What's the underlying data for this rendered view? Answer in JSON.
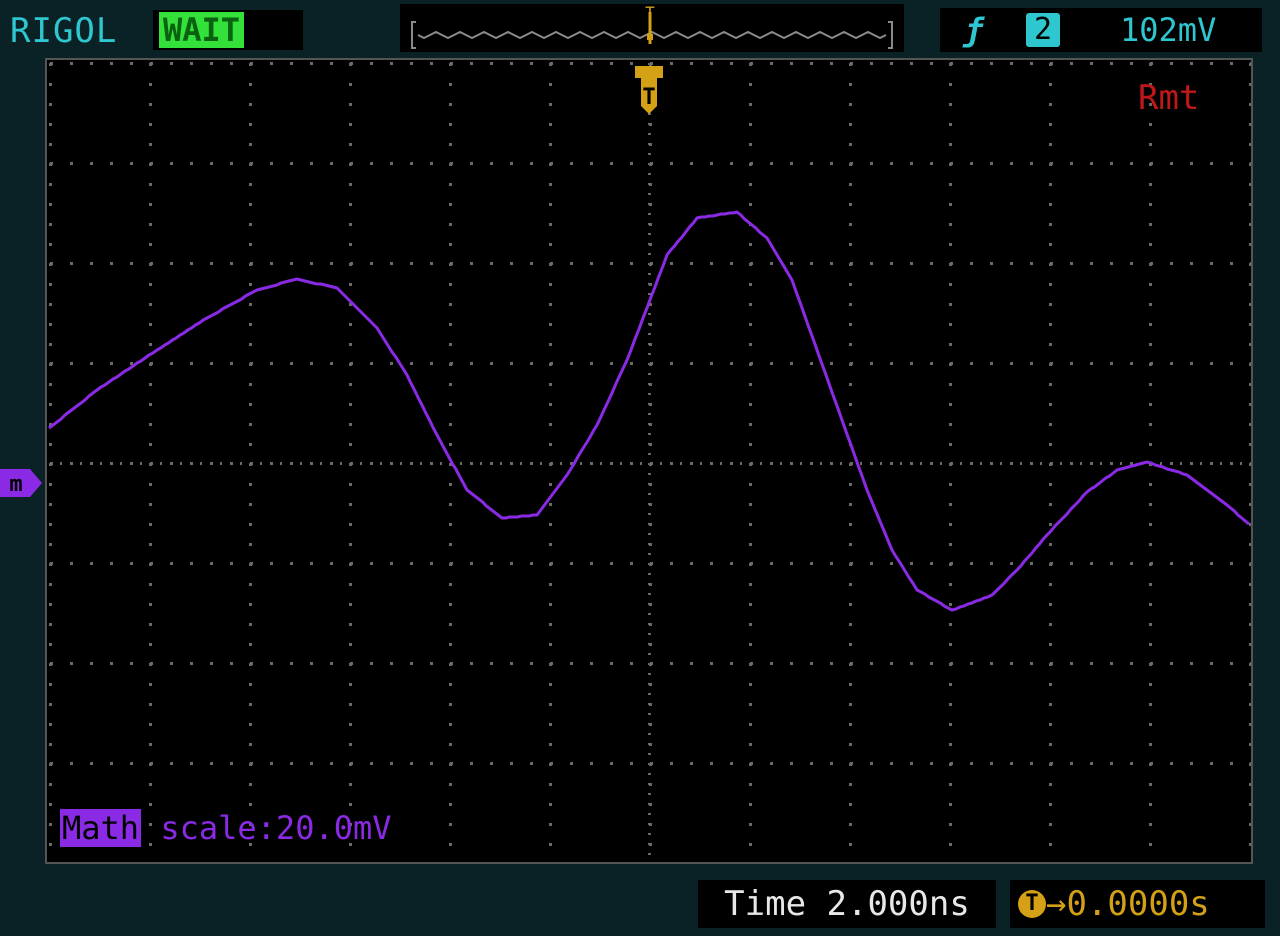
{
  "header": {
    "brand": "RIGOL",
    "run_status": "WAIT",
    "trigger_channel": "2",
    "trigger_level": "102mV",
    "trigger_slope_icon": "rising-edge-icon"
  },
  "screen": {
    "remote_indicator": "Rmt",
    "trigger_marker": "T",
    "math_marker": "m",
    "grid": {
      "horizontal_divisions": 12,
      "vertical_divisions": 8
    }
  },
  "math": {
    "tag": "Math",
    "scale_text": " scale:20.0mV",
    "color": "#8a2ae4"
  },
  "footer": {
    "timebase": "Time 2.000ns",
    "trigger_offset": "0.0000s",
    "trigger_offset_icon": "T"
  },
  "colors": {
    "background": "#0a2226",
    "accent": "#2ec6cf",
    "trigger": "#d4a015",
    "run_status": "#34e03a",
    "remote": "#c01818",
    "trace": "#8a2ae4"
  }
}
